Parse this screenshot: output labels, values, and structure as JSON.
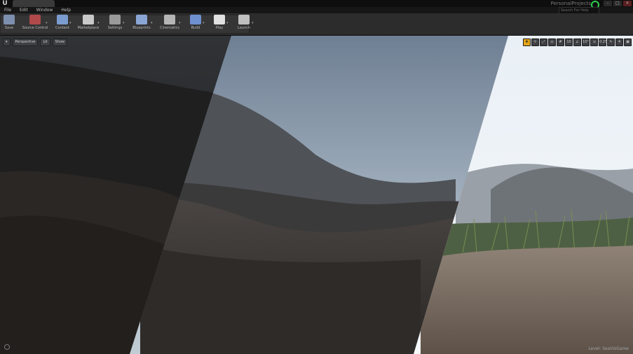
{
  "window": {
    "logo": "U",
    "project_name": "PersonalProjects",
    "search_placeholder": "Search For Help",
    "controls": [
      "–",
      "□",
      "✕"
    ]
  },
  "menu": [
    "File",
    "Edit",
    "Window",
    "Help"
  ],
  "toolbar": {
    "buttons": [
      {
        "label": "Save",
        "icon": "save-icon",
        "color": "#7d8fae"
      },
      {
        "label": "Source Control",
        "icon": "source-control-icon",
        "color": "#b04a4a"
      },
      {
        "label": "Content",
        "icon": "content-icon",
        "color": "#7b9ccf"
      },
      {
        "label": "Marketplace",
        "icon": "marketplace-icon",
        "color": "#c9c9c9"
      },
      {
        "label": "Settings",
        "icon": "settings-icon",
        "color": "#9a9a9a"
      },
      {
        "label": "Blueprints",
        "icon": "blueprints-icon",
        "color": "#8aa6d4"
      },
      {
        "label": "Cinematics",
        "icon": "cinematics-icon",
        "color": "#b5b5b5"
      },
      {
        "label": "Build",
        "icon": "build-icon",
        "color": "#6e90cf"
      },
      {
        "label": "Play",
        "icon": "play-icon",
        "color": "#e0e0e0"
      },
      {
        "label": "Launch",
        "icon": "launch-icon",
        "color": "#c0c0c0"
      }
    ]
  },
  "viewport": {
    "left_buttons": [
      "▾",
      "Perspective",
      "Lit",
      "Show"
    ],
    "right_icons": [
      {
        "glyph": "✥",
        "icon": "translate-icon",
        "active": true
      },
      {
        "glyph": "⟳",
        "icon": "rotate-icon",
        "active": false
      },
      {
        "glyph": "⤢",
        "icon": "scale-icon",
        "active": false
      },
      {
        "glyph": "◎",
        "icon": "world-local-icon",
        "active": false
      },
      {
        "glyph": "#",
        "icon": "grid-snap-icon",
        "active": false
      },
      {
        "glyph": "10",
        "icon": "grid-size-icon",
        "active": false
      },
      {
        "glyph": "∠",
        "icon": "rotation-snap-icon",
        "active": false
      },
      {
        "glyph": "10°",
        "icon": "rotation-size-icon",
        "active": false
      },
      {
        "glyph": "⇲",
        "icon": "scale-snap-icon",
        "active": false
      },
      {
        "glyph": "0.25",
        "icon": "scale-size-icon",
        "active": false
      },
      {
        "glyph": "✎",
        "icon": "camera-speed-icon",
        "active": false
      },
      {
        "glyph": "4",
        "icon": "camera-speed-value-icon",
        "active": false
      },
      {
        "glyph": "▣",
        "icon": "maximize-icon",
        "active": false
      }
    ],
    "level_label": "Level: SeaVisGame"
  }
}
